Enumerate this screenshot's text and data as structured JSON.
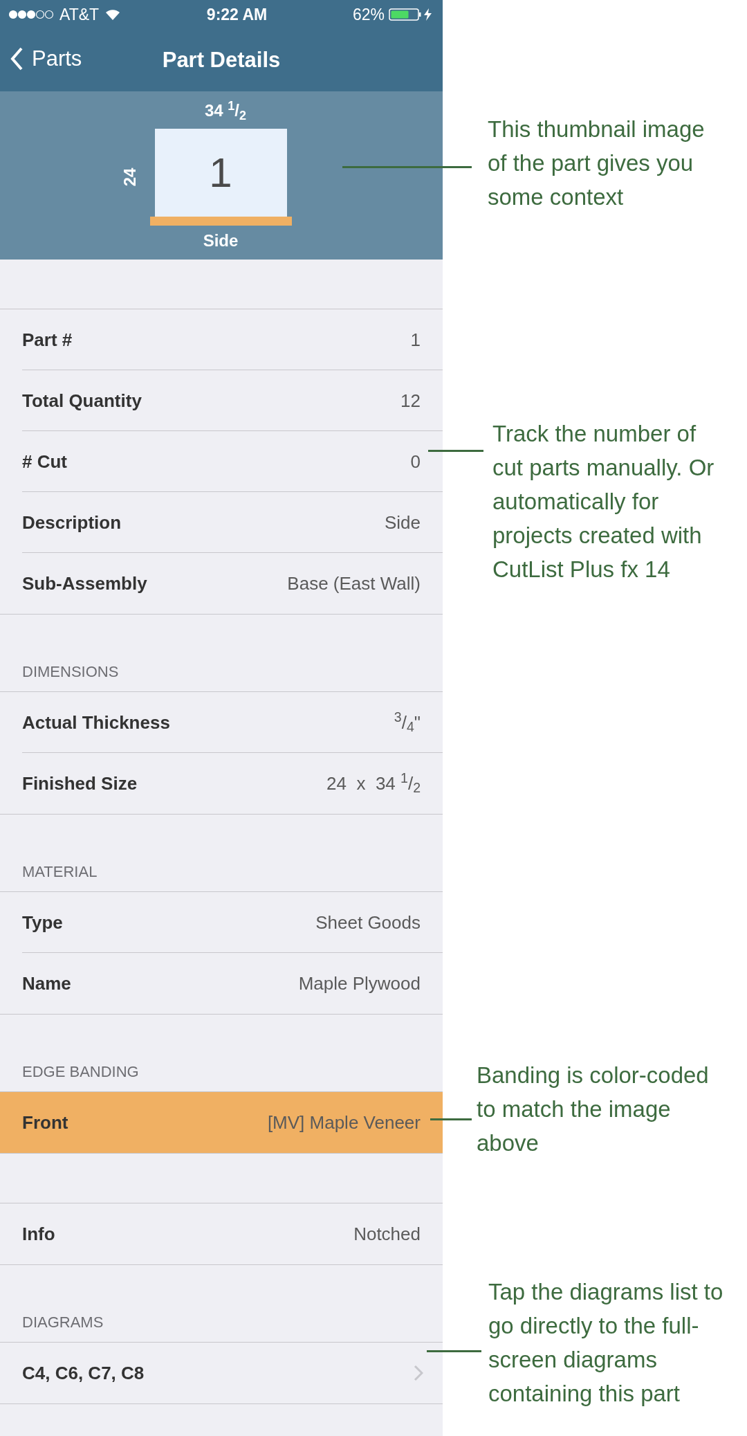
{
  "status_bar": {
    "carrier": "AT&T",
    "time": "9:22 AM",
    "battery": "62%"
  },
  "nav": {
    "back": "Parts",
    "title": "Part Details"
  },
  "thumbnail": {
    "width_label": "34 $^{1}$/$_{2}$",
    "height_label": "24",
    "number": "1",
    "name": "Side",
    "color": "#f0b063"
  },
  "sections": [
    {
      "rows": [
        {
          "kind": "plain",
          "label": "Part #",
          "value": "1"
        },
        {
          "kind": "plain",
          "label": "Total Quantity",
          "value": "12"
        },
        {
          "kind": "plain",
          "label": "# Cut",
          "value": "0"
        },
        {
          "kind": "plain",
          "label": "Description",
          "value": "Side"
        },
        {
          "kind": "plain",
          "label": "Sub-Assembly",
          "value": "Base (East Wall)"
        }
      ]
    },
    {
      "header": "DIMENSIONS",
      "rows": [
        {
          "kind": "plain",
          "label": "Actual Thickness",
          "value": "$^{3}$/$_{4}$\""
        },
        {
          "kind": "plain",
          "label": "Finished Size",
          "value": "24  x  34 $^{1}$/$_{2}$"
        }
      ]
    },
    {
      "header": "MATERIAL",
      "rows": [
        {
          "kind": "plain",
          "label": "Type",
          "value": "Sheet Goods"
        },
        {
          "kind": "plain",
          "label": "Name",
          "value": "Maple Plywood"
        }
      ]
    },
    {
      "header": "EDGE BANDING",
      "rows": [
        {
          "kind": "banded",
          "label": "Front",
          "value": "[MV] Maple Veneer",
          "color": "#f0b063"
        }
      ]
    },
    {
      "rows": [
        {
          "kind": "plain",
          "label": "Info",
          "value": "Notched"
        }
      ]
    },
    {
      "header": "DIAGRAMS",
      "rows": [
        {
          "kind": "link",
          "label": "C4, C6, C7, C8"
        }
      ]
    }
  ],
  "annotations": [
    {
      "text": "This thumbnail image of the part gives you some context"
    },
    {
      "text": "Track the number of cut parts manually. Or automatically for projects created with CutList Plus fx 14"
    },
    {
      "text": "Banding is color-coded to match the image above"
    },
    {
      "text": "Tap the diagrams list to go directly to the full-screen diagrams containing this part"
    }
  ]
}
